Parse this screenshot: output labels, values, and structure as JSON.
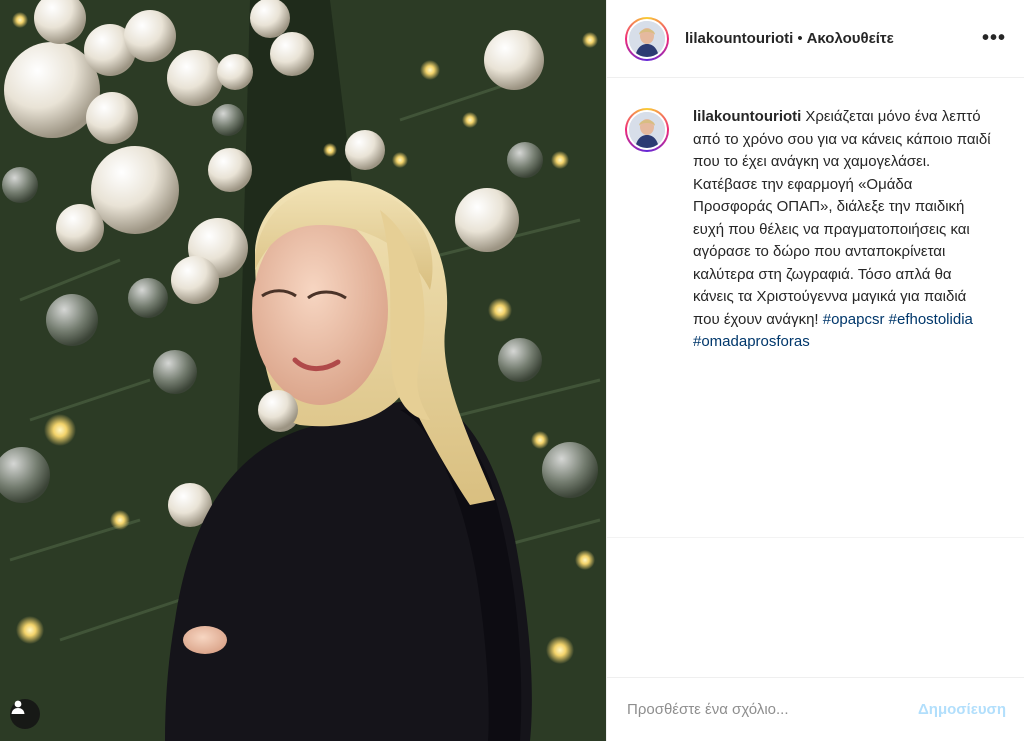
{
  "post": {
    "username": "lilakountourioti",
    "separator": "•",
    "follow_label": "Ακολουθείτε",
    "more_icon": "more-options-icon"
  },
  "caption": {
    "username": "lilakountourioti",
    "text": "Χρειάζεται μόνο ένα λεπτό από το χρόνο σου για να κάνεις κάποιο παιδί που το έχει ανάγκη να χαμογελάσει. Κατέβασε την εφαρμογή «Ομάδα Προσφοράς ΟΠΑΠ», διάλεξε την παιδική ευχή που θέλεις να πραγματοποιήσεις και αγόρασε το δώρο που ανταποκρίνεται καλύτερα στη ζωγραφιά. Τόσο απλά θα κάνεις τα Χριστούγεννα μαγικά για παιδιά που έχουν ανάγκη!",
    "hashtags": [
      "#opapcsr",
      "#efhostolidia",
      "#omadaprosforas"
    ]
  },
  "comment": {
    "placeholder": "Προσθέστε ένα σχόλιο...",
    "post_label": "Δημοσίευση"
  },
  "colors": {
    "link": "#00376b",
    "post_button_disabled": "#b2dffc",
    "text": "#262626"
  }
}
